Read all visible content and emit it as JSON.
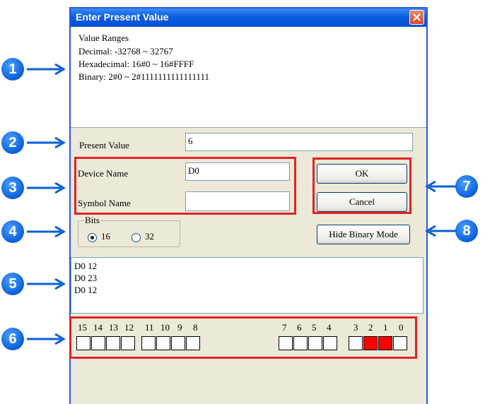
{
  "dialog": {
    "title": "Enter Present Value",
    "value_ranges": {
      "heading": "Value Ranges",
      "decimal": "Decimal: -32768 ~ 32767",
      "hexadecimal": "Hexadecimal: 16#0 ~ 16#FFFF",
      "binary": "Binary: 2#0 ~ 2#1111111111111111"
    },
    "present_value_label": "Present Value",
    "present_value": "6",
    "device_name_label": "Device Name",
    "device_name": "D0",
    "symbol_name_label": "Symbol Name",
    "symbol_name": "",
    "ok_label": "OK",
    "cancel_label": "Cancel",
    "bits_label": "Bits",
    "bits_options": [
      "16",
      "32"
    ],
    "bits_selected": "16",
    "hide_binary_label": "Hide Binary Mode",
    "device_list": [
      "D0 12",
      "D0 23",
      "D0 12"
    ],
    "bit_labels_high": [
      "15",
      "14",
      "13",
      "12",
      "11",
      "10",
      "9",
      "8"
    ],
    "bit_labels_low": [
      "7",
      "6",
      "5",
      "4",
      "3",
      "2",
      "1",
      "0"
    ],
    "bit_states": [
      0,
      0,
      0,
      0,
      0,
      0,
      0,
      0,
      0,
      0,
      0,
      0,
      0,
      1,
      1,
      0
    ]
  },
  "callouts": [
    "1",
    "2",
    "3",
    "4",
    "5",
    "6",
    "7",
    "8"
  ],
  "colors": {
    "callout": "#0a5fd8",
    "highlight": "#e32226",
    "bit_on": "#ff0000"
  }
}
